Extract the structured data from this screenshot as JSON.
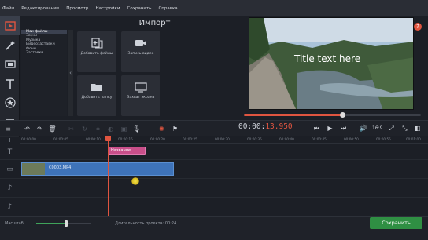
{
  "menu": [
    "Файл",
    "Редактирование",
    "Просмотр",
    "Настройки",
    "Сохранить",
    "Справка"
  ],
  "sidebar_left": {
    "icons": [
      "import-icon",
      "magic-wand-icon",
      "film-strip-icon",
      "title-icon",
      "star-icon",
      "menu-icon"
    ]
  },
  "import_panel": {
    "title": "Импорт",
    "categories": [
      "Мои файлы",
      "Звуки",
      "Музыка",
      "Видеозаставки",
      "Фоны",
      "Заставки"
    ],
    "tiles": [
      {
        "label": "Добавить файлы",
        "icon": "add-files-icon"
      },
      {
        "label": "Запись видео",
        "icon": "video-camera-icon"
      },
      {
        "label": "Добавить папку",
        "icon": "folder-icon"
      },
      {
        "label": "Захват экрана",
        "icon": "screen-capture-icon"
      }
    ]
  },
  "preview": {
    "overlay_text": "Title text here",
    "scrub_progress": 0.56
  },
  "toolbar": {
    "timecode_prefix": "00:00:",
    "timecode_highlight": "13.950",
    "aspect": "16:9",
    "icons": [
      "undo-icon",
      "redo-icon",
      "delete-icon",
      "cut-icon",
      "rotate-icon",
      "crop-icon",
      "color-icon",
      "stabilize-icon",
      "mic-icon",
      "equalizer-icon",
      "settings-icon",
      "flag-icon"
    ]
  },
  "timeline": {
    "ticks": [
      "00:00:00",
      "00:00:05",
      "00:00:10",
      "00:00:15",
      "00:00:20",
      "00:00:25",
      "00:00:30",
      "00:00:35",
      "00:00:40",
      "00:00:45",
      "00:00:50",
      "00:00:55",
      "00:01:00"
    ],
    "title_clip": "Название",
    "video_clip": "C0003.MP4"
  },
  "bottom": {
    "zoom_label": "Масштаб:",
    "duration_label": "Длительность проекта: 00:24",
    "save_button": "Сохранить"
  },
  "colors": {
    "accent": "#e05540",
    "clip": "#3e73b9",
    "title_clip": "#c94f8a",
    "save": "#2f8f43"
  }
}
